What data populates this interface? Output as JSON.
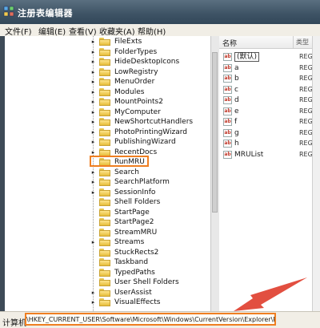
{
  "window": {
    "title": "注册表编辑器"
  },
  "menu": [
    "文件(F)",
    "编辑(E)",
    "查看(V)",
    "收藏夹(A)",
    "帮助(H)"
  ],
  "tree": {
    "selected": "RunMRU",
    "items": [
      {
        "label": "FileExts",
        "expander": "▸"
      },
      {
        "label": "FolderTypes",
        "expander": "▸"
      },
      {
        "label": "HideDesktopIcons",
        "expander": "▸"
      },
      {
        "label": "LowRegistry",
        "expander": "▸"
      },
      {
        "label": "MenuOrder",
        "expander": "▸"
      },
      {
        "label": "Modules",
        "expander": "▸"
      },
      {
        "label": "MountPoints2",
        "expander": "▸"
      },
      {
        "label": "MyComputer",
        "expander": "▸"
      },
      {
        "label": "NewShortcutHandlers",
        "expander": "▸"
      },
      {
        "label": "PhotoPrintingWizard",
        "expander": "▸"
      },
      {
        "label": "PublishingWizard",
        "expander": "▸"
      },
      {
        "label": "RecentDocs",
        "expander": "▸"
      },
      {
        "label": "RunMRU",
        "expander": ""
      },
      {
        "label": "Search",
        "expander": "▸"
      },
      {
        "label": "SearchPlatform",
        "expander": "▸"
      },
      {
        "label": "SessionInfo",
        "expander": "▸"
      },
      {
        "label": "Shell Folders",
        "expander": ""
      },
      {
        "label": "StartPage",
        "expander": ""
      },
      {
        "label": "StartPage2",
        "expander": ""
      },
      {
        "label": "StreamMRU",
        "expander": ""
      },
      {
        "label": "Streams",
        "expander": "▸"
      },
      {
        "label": "StuckRects2",
        "expander": ""
      },
      {
        "label": "Taskband",
        "expander": ""
      },
      {
        "label": "TypedPaths",
        "expander": ""
      },
      {
        "label": "User Shell Folders",
        "expander": ""
      },
      {
        "label": "UserAssist",
        "expander": "▸"
      },
      {
        "label": "VisualEffects",
        "expander": "▸"
      }
    ]
  },
  "list": {
    "col_name": "名称",
    "col_type": "类型",
    "rows": [
      {
        "name": "(默认)",
        "type": "REG_"
      },
      {
        "name": "a",
        "type": "REG_"
      },
      {
        "name": "b",
        "type": "REG_"
      },
      {
        "name": "c",
        "type": "REG_"
      },
      {
        "name": "d",
        "type": "REG_"
      },
      {
        "name": "e",
        "type": "REG_"
      },
      {
        "name": "f",
        "type": "REG_"
      },
      {
        "name": "g",
        "type": "REG_"
      },
      {
        "name": "h",
        "type": "REG_"
      },
      {
        "name": "MRUList",
        "type": "REG_"
      }
    ]
  },
  "status": {
    "computer": "计算机",
    "path": "\\HKEY_CURRENT_USER\\Software\\Microsoft\\Windows\\CurrentVersion\\Explorer\\RunMRU"
  },
  "colors": {
    "highlight": "#ef7f22",
    "arrow": "#e04030"
  },
  "icons": {
    "app": "registry-icon",
    "folder": "folder-icon",
    "value": "string-value-icon"
  }
}
